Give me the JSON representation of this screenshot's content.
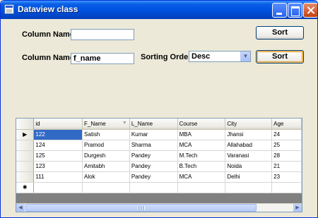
{
  "window": {
    "title": "Dataview class",
    "icon": "form-icon"
  },
  "form": {
    "column_name_label_1": "Column Name",
    "column_name_value_1": "",
    "column_name_label_2": "Column Name",
    "column_name_value_2": "f_name",
    "sorting_order_label": "Sorting Order",
    "sorting_order_value": "Desc",
    "sort_button_1": "Sort",
    "sort_button_2": "Sort"
  },
  "grid": {
    "columns": [
      "id",
      "F_Name",
      "L_Name",
      "Course",
      "City",
      "Age"
    ],
    "sorted_column": "F_Name",
    "rows": [
      [
        "122",
        "Satish",
        "Kumar",
        "MBA",
        "Jhansi",
        "24"
      ],
      [
        "124",
        "Pramod",
        "Sharma",
        "MCA",
        "Allahabad",
        "25"
      ],
      [
        "125",
        "Durgesh",
        "Pandey",
        "M.Tech",
        "Varanasi",
        "28"
      ],
      [
        "123",
        "Amitabh",
        "Pandey",
        "B.Tech",
        "Noida",
        "21"
      ],
      [
        "111",
        "Alok",
        "Pandey",
        "MCA",
        "Delhi",
        "23"
      ]
    ],
    "current_row_marker": "▶",
    "new_row_marker": "✱"
  },
  "colors": {
    "titlebar": "#0054e3",
    "form_background": "#ece9d8",
    "selection": "#316ac5"
  }
}
